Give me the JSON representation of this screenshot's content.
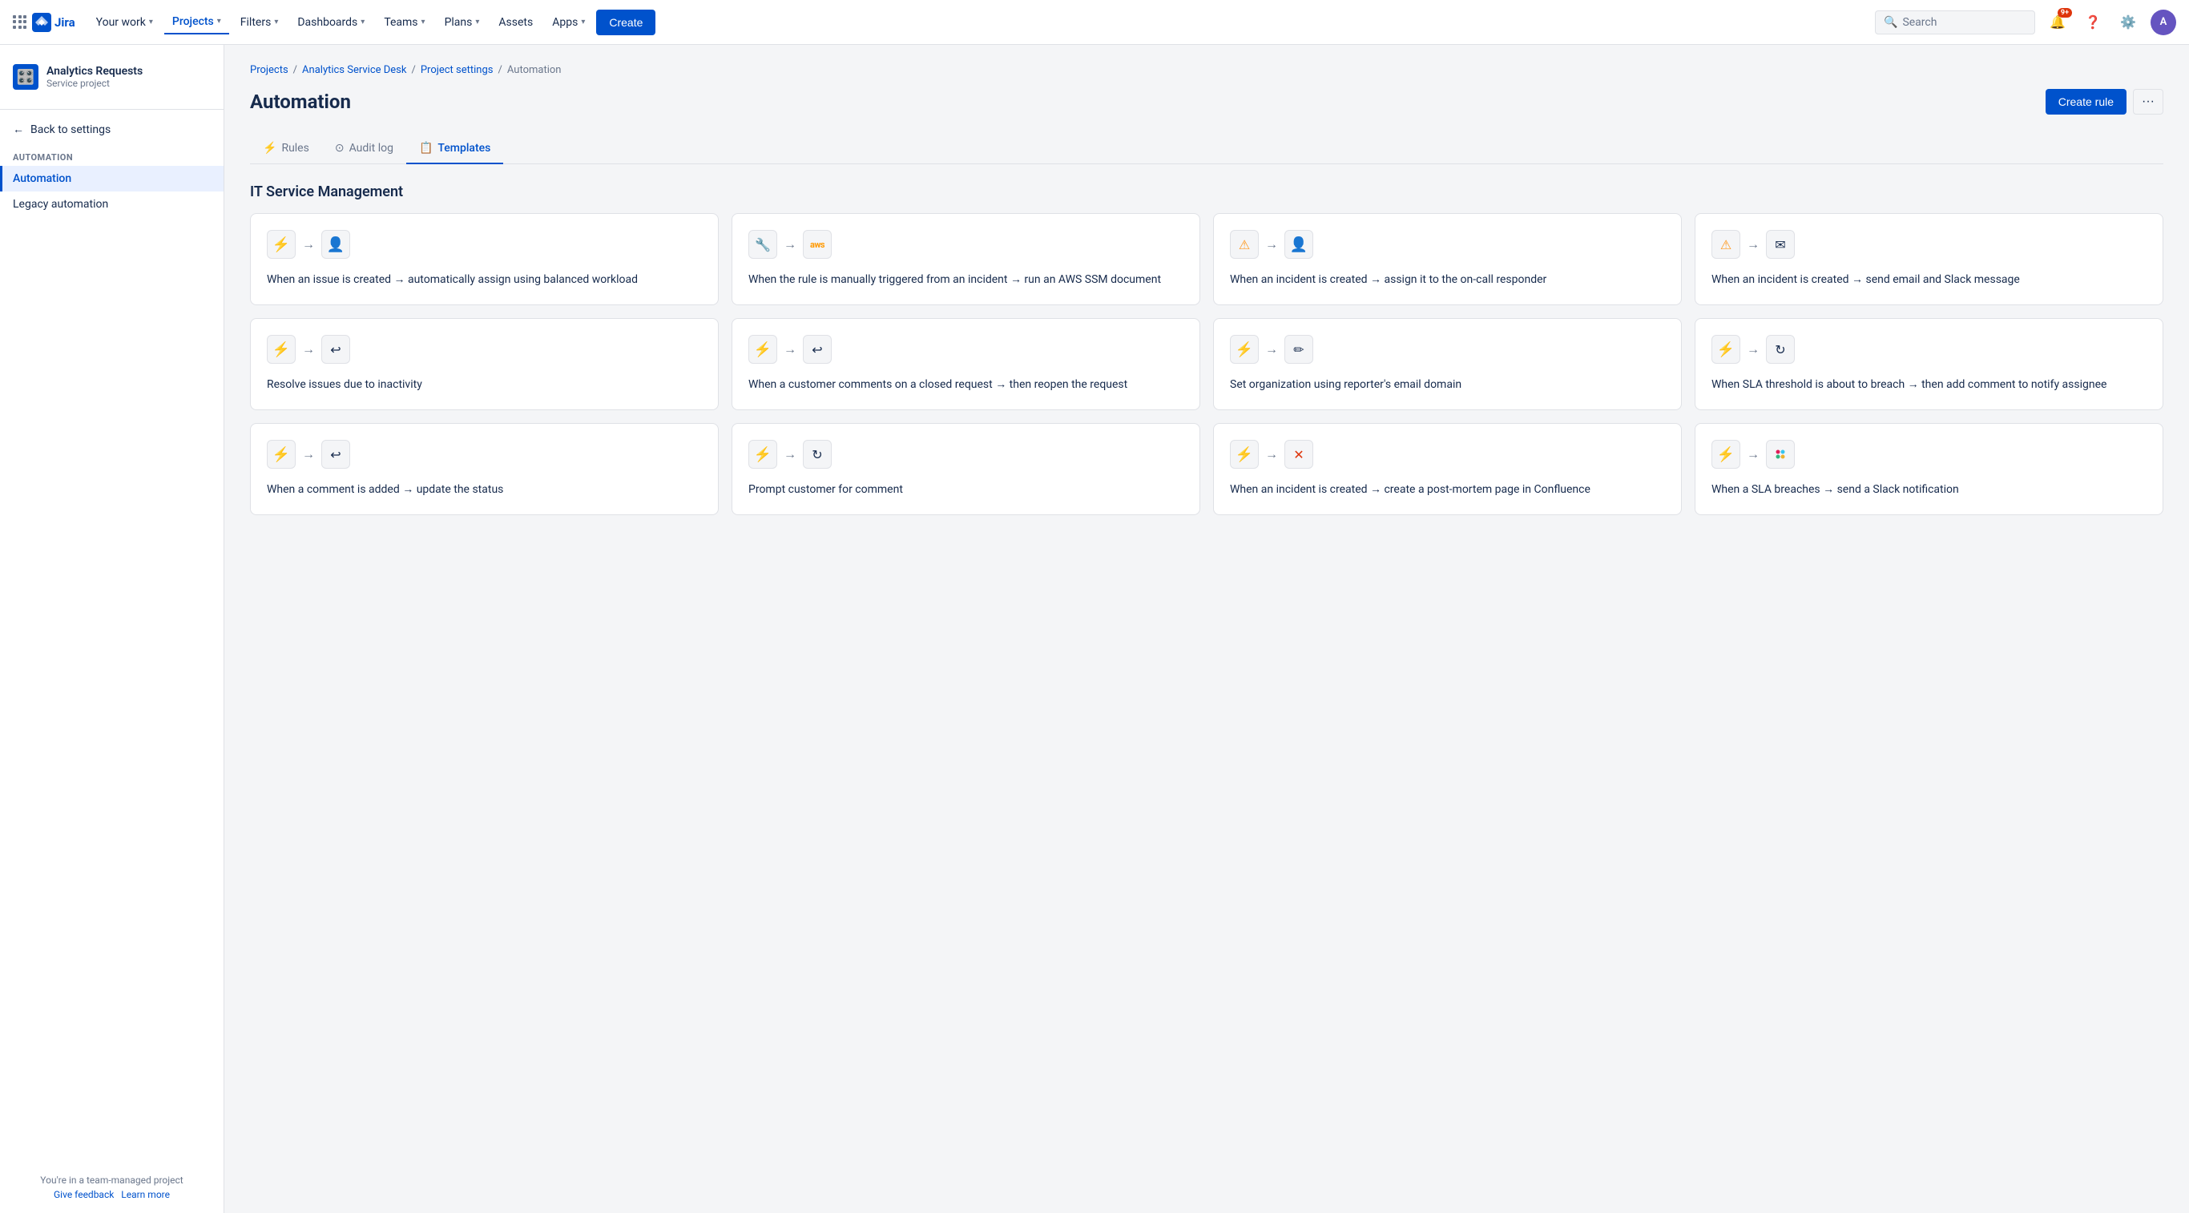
{
  "topnav": {
    "logo_text": "Jira",
    "nav_items": [
      {
        "label": "Your work",
        "chevron": true,
        "active": false
      },
      {
        "label": "Projects",
        "chevron": true,
        "active": true
      },
      {
        "label": "Filters",
        "chevron": true,
        "active": false
      },
      {
        "label": "Dashboards",
        "chevron": true,
        "active": false
      },
      {
        "label": "Teams",
        "chevron": true,
        "active": false
      },
      {
        "label": "Plans",
        "chevron": true,
        "active": false
      },
      {
        "label": "Assets",
        "chevron": false,
        "active": false
      },
      {
        "label": "Apps",
        "chevron": true,
        "active": false
      }
    ],
    "create_label": "Create",
    "search_placeholder": "Search",
    "notifications_badge": "9+",
    "avatar_initials": "A"
  },
  "sidebar": {
    "project_name": "Analytics Requests",
    "project_type": "Service project",
    "back_label": "Back to settings",
    "automation_section": "AUTOMATION",
    "items": [
      {
        "label": "Automation",
        "active": true
      },
      {
        "label": "Legacy automation",
        "active": false
      }
    ],
    "footer_text": "You're in a team-managed project",
    "feedback_label": "Give feedback",
    "learn_label": "Learn more"
  },
  "breadcrumb": {
    "items": [
      "Projects",
      "Analytics Service Desk",
      "Project settings",
      "Automation"
    ]
  },
  "page": {
    "title": "Automation",
    "create_rule_label": "Create rule",
    "more_label": "···"
  },
  "tabs": [
    {
      "label": "Rules",
      "icon": "⚡",
      "active": false
    },
    {
      "label": "Audit log",
      "icon": "○",
      "active": false
    },
    {
      "label": "Templates",
      "icon": "📋",
      "active": true
    }
  ],
  "section": {
    "title": "IT Service Management"
  },
  "cards": [
    {
      "icon1": "⚡",
      "icon1_style": "lightning",
      "icon2": "👤",
      "icon2_style": "person",
      "text": "When an issue is created → automatically assign using balanced workload"
    },
    {
      "icon1": "🔧",
      "icon1_style": "wrench",
      "icon2": "aws",
      "icon2_style": "aws",
      "text": "When the rule is manually triggered from an incident → run an AWS SSM document"
    },
    {
      "icon1": "⚠",
      "icon1_style": "warning",
      "icon2": "👤",
      "icon2_style": "person",
      "text": "When an incident is created → assign it to the on-call responder"
    },
    {
      "icon1": "⚠",
      "icon1_style": "warning",
      "icon2": "✉",
      "icon2_style": "email",
      "text": "When an incident is created → send email and Slack message"
    },
    {
      "icon1": "⚡",
      "icon1_style": "lightning",
      "icon2": "↩",
      "icon2_style": "reopen",
      "text": "Resolve issues due to inactivity"
    },
    {
      "icon1": "⚡",
      "icon1_style": "lightning",
      "icon2": "↩",
      "icon2_style": "reopen",
      "text": "When a customer comments on a closed request → then reopen the request"
    },
    {
      "icon1": "⚡",
      "icon1_style": "lightning",
      "icon2": "✏",
      "icon2_style": "edit",
      "text": "Set organization using reporter's email domain"
    },
    {
      "icon1": "⚡",
      "icon1_style": "lightning",
      "icon2": "↻",
      "icon2_style": "refresh",
      "text": "When SLA threshold is about to breach → then add comment to notify assignee"
    },
    {
      "icon1": "⚡",
      "icon1_style": "lightning",
      "icon2": "↩",
      "icon2_style": "reopen",
      "text": "When a comment is added → update the status"
    },
    {
      "icon1": "⚡",
      "icon1_style": "lightning",
      "icon2": "↻",
      "icon2_style": "refresh",
      "text": "Prompt customer for comment"
    },
    {
      "icon1": "⚡",
      "icon1_style": "lightning",
      "icon2": "✕",
      "icon2_style": "close",
      "text": "When an incident is created → create a post-mortem page in Confluence"
    },
    {
      "icon1": "⚡",
      "icon1_style": "lightning",
      "icon2": "slack",
      "icon2_style": "slack",
      "text": "When a SLA breaches → send a Slack notification"
    }
  ]
}
